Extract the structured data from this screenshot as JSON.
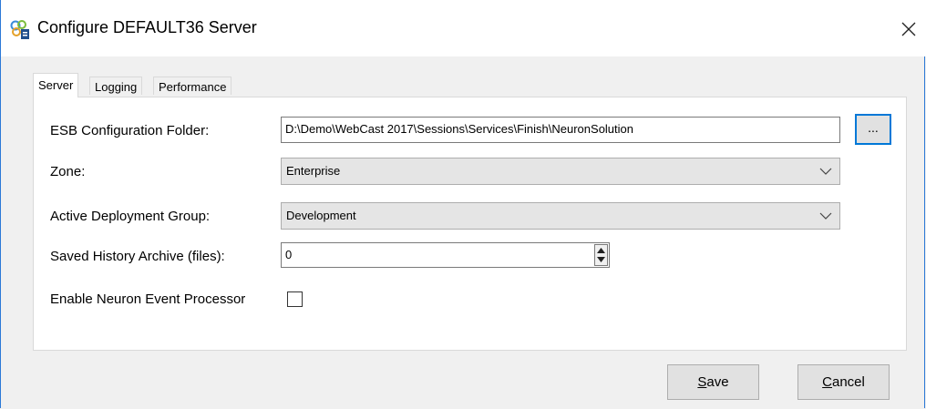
{
  "window": {
    "title": "Configure DEFAULT36 Server",
    "icon": "server-config-icon",
    "close_icon": "close-icon"
  },
  "tabs": [
    {
      "label": "Server",
      "active": true
    },
    {
      "label": "Logging",
      "active": false
    },
    {
      "label": "Performance",
      "active": false
    }
  ],
  "form": {
    "esb_folder": {
      "label": "ESB Configuration Folder:",
      "value": "D:\\Demo\\WebCast 2017\\Sessions\\Services\\Finish\\NeuronSolution",
      "browse_label": "..."
    },
    "zone": {
      "label": "Zone:",
      "value": "Enterprise"
    },
    "deployment_group": {
      "label": "Active Deployment Group:",
      "value": "Development"
    },
    "history_archive": {
      "label": "Saved History Archive (files):",
      "value": "0"
    },
    "event_processor": {
      "label": "Enable Neuron Event Processor",
      "checked": false
    }
  },
  "buttons": {
    "save_mnemonic": "S",
    "save_rest": "ave",
    "cancel_mnemonic": "C",
    "cancel_rest": "ancel"
  },
  "colors": {
    "accent": "#0078d7",
    "panel_bg": "#ffffff",
    "window_bg": "#f0f0f0"
  }
}
